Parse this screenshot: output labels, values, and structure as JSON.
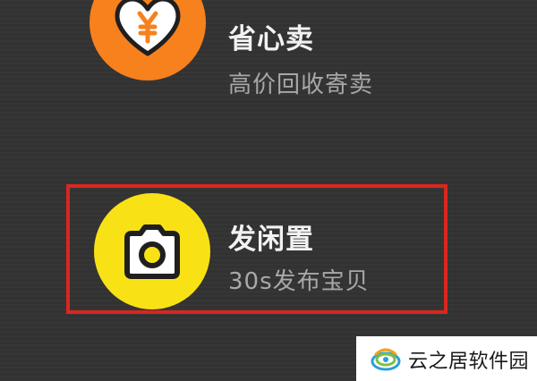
{
  "options": [
    {
      "id": "sell",
      "title": "省心卖",
      "subtitle": "高价回收寄卖",
      "icon": "heart-yen-icon",
      "color": "#f7811d"
    },
    {
      "id": "post",
      "title": "发闲置",
      "subtitle": "30s发布宝贝",
      "icon": "camera-icon",
      "color": "#f8e215"
    }
  ],
  "highlight_color": "#d9261f",
  "watermark": {
    "text": "云之居软件园"
  }
}
